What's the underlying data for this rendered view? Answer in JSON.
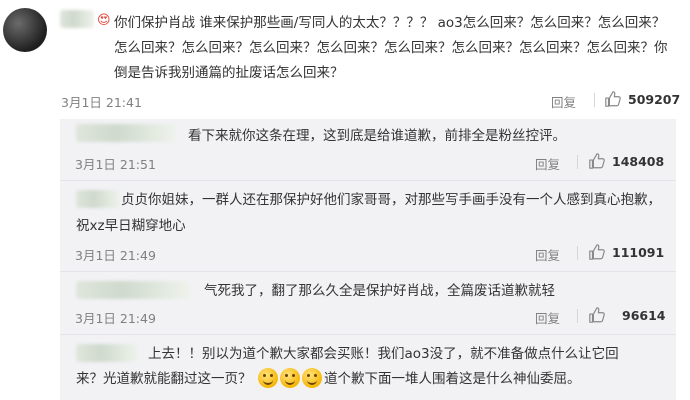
{
  "main_comment": {
    "emoji_label": "😍",
    "text": "你们保护肖战  谁来保护那些画/写同人的太太？？？？  ao3怎么回来？怎么回来？怎么回来？怎么回来？怎么回来？怎么回来？怎么回来？怎么回来？怎么回来？怎么回来？怎么回来？你倒是告诉我别通篇的扯废话怎么回来？",
    "date": "3月1日 21:41",
    "reply_label": "回复",
    "likes": "509207"
  },
  "replies": [
    {
      "text": "看下来就你这条在理，这到底是给谁道歉，前排全是粉丝控评。",
      "date": "3月1日 21:51",
      "reply_label": "回复",
      "likes": "148408"
    },
    {
      "text": "贞贞你姐妹，一群人还在那保护好他们家哥哥，对那些写手画手没有一个人感到真心抱歉，祝xz早日糊穿地心",
      "date": "3月1日 21:49",
      "reply_label": "回复",
      "likes": "111091"
    },
    {
      "text": "气死我了，翻了那么久全是保护好肖战，全篇废话道歉就轻",
      "date": "3月1日 21:49",
      "reply_label": "回复",
      "likes": "96614"
    },
    {
      "text_line1": "上去！！别以为道个歉大家都会买账！我们ao3没了，就不准备做点什么让它回",
      "text_line2a": "来？光道歉就能翻过这一页？",
      "text_line2b": "道个歉下面一堆人围着这是什么神仙委屈。"
    }
  ],
  "icons": {
    "thumb": "thumbs-up-icon",
    "avatar": "avatar"
  },
  "colors": {
    "reply_bg": "#f2f2f5",
    "meta_text": "#808080"
  }
}
